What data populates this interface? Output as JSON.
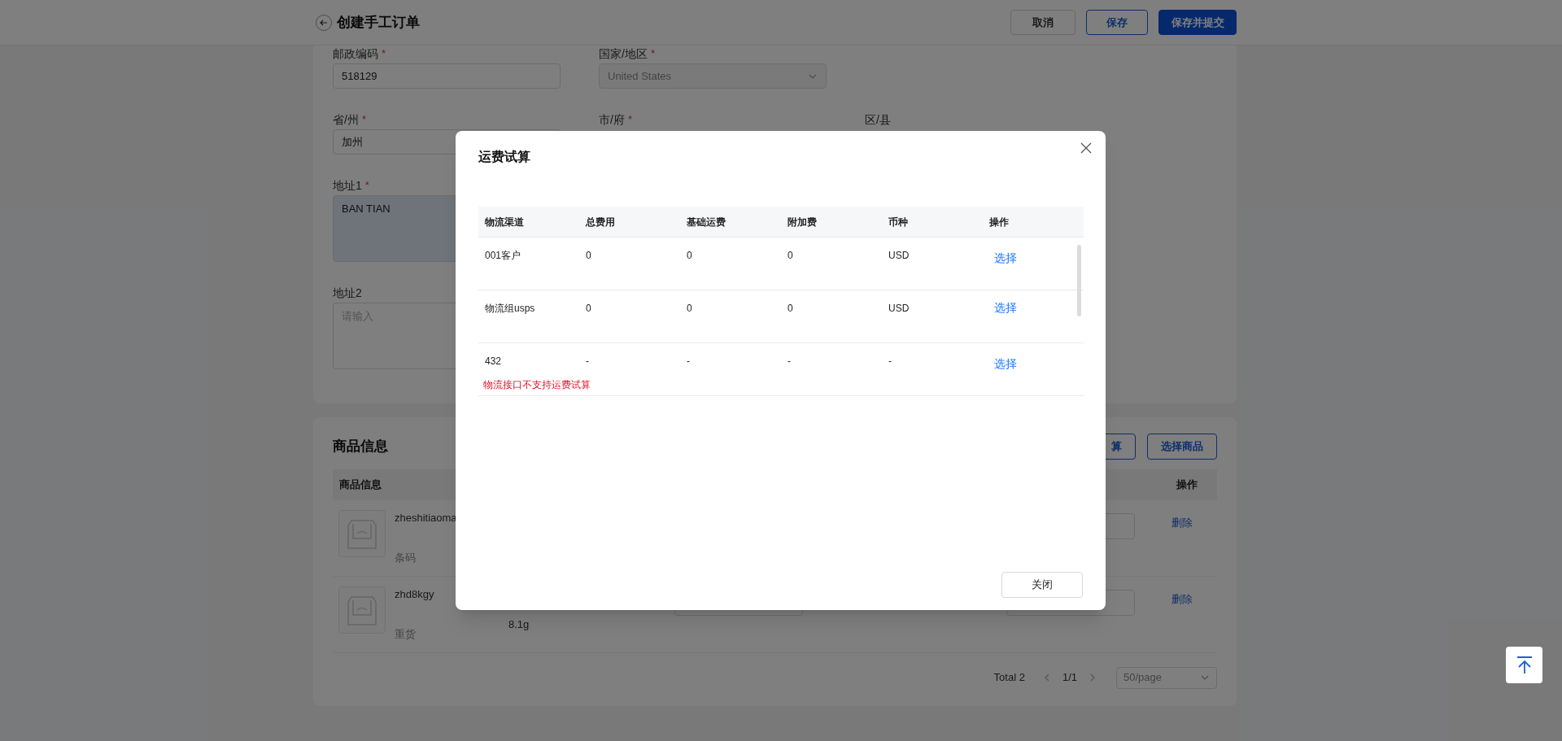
{
  "header": {
    "title": "创建手工订单",
    "buttons": [
      {
        "label": "取消",
        "kind": "default"
      },
      {
        "label": "保存",
        "kind": "outline"
      },
      {
        "label": "保存并提交",
        "kind": "primary"
      }
    ]
  },
  "form": {
    "rows": [
      [
        {
          "label": "邮政编码",
          "mark": "*",
          "kind": "input",
          "value": "518129"
        },
        {
          "label": "国家/地区",
          "mark": "*",
          "kind": "select",
          "value": "United States",
          "disabled": true
        }
      ],
      [
        {
          "label": "省/州",
          "mark": "*",
          "kind": "input",
          "value": "加州"
        },
        {
          "label": "市/府",
          "mark": "*"
        },
        {
          "label": "区/县"
        }
      ],
      [
        {
          "label": "地址1",
          "mark": "*",
          "kind": "textarea",
          "value": "BAN TIAN",
          "autofilled": true
        }
      ],
      [
        {
          "label": "地址2",
          "kind": "textarea",
          "placeholder": "请输入",
          "autofilled": false
        }
      ]
    ]
  },
  "products": {
    "title": "商品信息",
    "buttons": [
      "算",
      "选择商品"
    ],
    "columns": [
      "商品信息",
      "操作"
    ],
    "rows": [
      {
        "name": "zheshitiaoma",
        "tag": "条码",
        "action": "删除"
      },
      {
        "name": "zhd8kgy",
        "tag": "重货",
        "weight": "8.1g",
        "action": "删除"
      }
    ],
    "pagination": {
      "total": "Total 2",
      "page": "1/1",
      "page_size": "50/page"
    }
  },
  "dialog": {
    "title": "运费试算",
    "columns": [
      "物流渠道",
      "总费用",
      "基础运费",
      "附加费",
      "币种",
      "操作"
    ],
    "rows": [
      {
        "cells": [
          "001客户",
          "0",
          "0",
          "0",
          "USD"
        ],
        "action": "选择"
      },
      {
        "cells": [
          "物流组usps",
          "0",
          "0",
          "0",
          "USD"
        ],
        "action": "选择"
      },
      {
        "cells": [
          "432",
          "-",
          "-",
          "-",
          "-"
        ],
        "action": "选择",
        "error": "物流接口不支持运费试算"
      }
    ],
    "close_button": "关闭"
  }
}
